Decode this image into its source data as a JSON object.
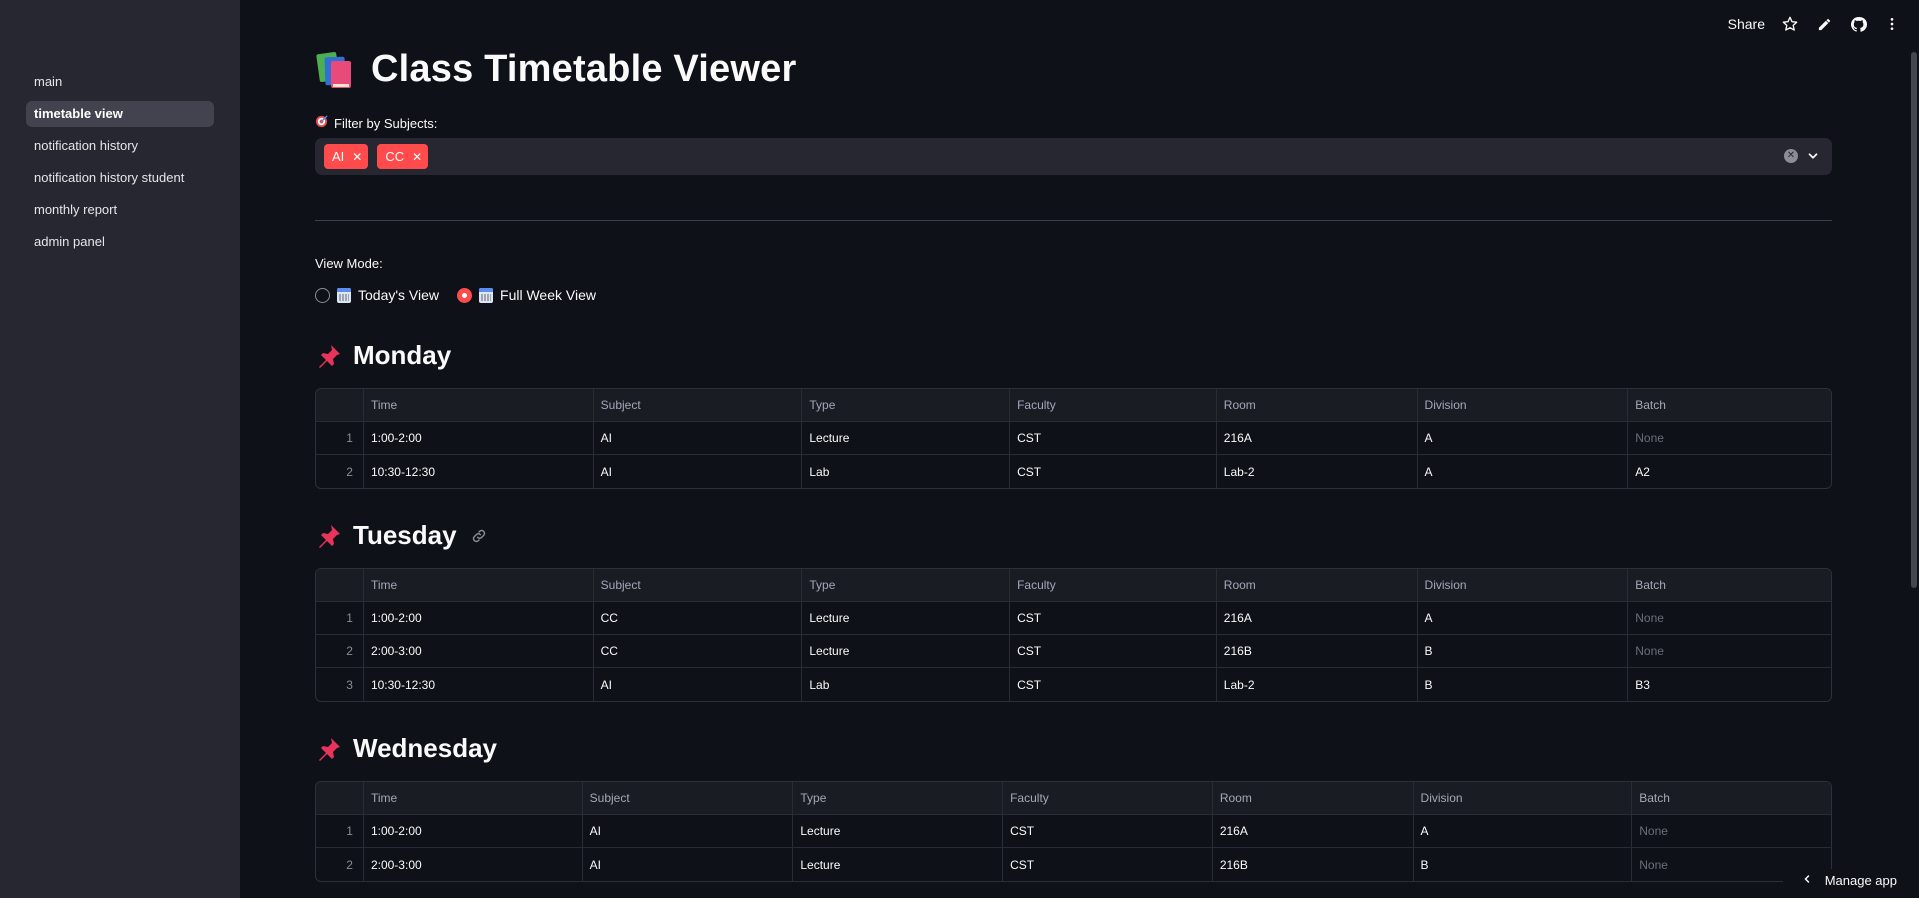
{
  "sidebar": {
    "items": [
      {
        "label": "main"
      },
      {
        "label": "timetable view"
      },
      {
        "label": "notification history"
      },
      {
        "label": "notification history student"
      },
      {
        "label": "monthly report"
      },
      {
        "label": "admin panel"
      }
    ]
  },
  "toolbar": {
    "share_label": "Share",
    "icons": [
      "star-icon",
      "pencil-icon",
      "github-icon",
      "more-vertical-icon"
    ]
  },
  "page": {
    "title": "Class Timetable Viewer",
    "title_icon": "books-emoji-icon"
  },
  "filter": {
    "label": "Filter by Subjects:",
    "label_icon": "target-icon",
    "tags": [
      {
        "label": "AI"
      },
      {
        "label": "CC"
      }
    ]
  },
  "view_mode": {
    "label": "View Mode:",
    "options": [
      {
        "label": "Today's View",
        "selected": false
      },
      {
        "label": "Full Week View",
        "selected": true
      }
    ]
  },
  "table_columns": [
    "Time",
    "Subject",
    "Type",
    "Faculty",
    "Room",
    "Division",
    "Batch"
  ],
  "days": [
    {
      "name": "Monday",
      "rows": [
        {
          "idx": "1",
          "cells": [
            "1:00-2:00",
            "AI",
            "Lecture",
            "CST",
            "216A",
            "A",
            "None"
          ]
        },
        {
          "idx": "2",
          "cells": [
            "10:30-12:30",
            "AI",
            "Lab",
            "CST",
            "Lab-2",
            "A",
            "A2"
          ]
        }
      ]
    },
    {
      "name": "Tuesday",
      "rows": [
        {
          "idx": "1",
          "cells": [
            "1:00-2:00",
            "CC",
            "Lecture",
            "CST",
            "216A",
            "A",
            "None"
          ]
        },
        {
          "idx": "2",
          "cells": [
            "2:00-3:00",
            "CC",
            "Lecture",
            "CST",
            "216B",
            "B",
            "None"
          ]
        },
        {
          "idx": "3",
          "cells": [
            "10:30-12:30",
            "AI",
            "Lab",
            "CST",
            "Lab-2",
            "B",
            "B3"
          ]
        }
      ]
    },
    {
      "name": "Wednesday",
      "rows": [
        {
          "idx": "1",
          "cells": [
            "1:00-2:00",
            "AI",
            "Lecture",
            "CST",
            "216A",
            "A",
            "None"
          ]
        },
        {
          "idx": "2",
          "cells": [
            "2:00-3:00",
            "AI",
            "Lecture",
            "CST",
            "216B",
            "B",
            "None"
          ]
        }
      ]
    }
  ],
  "manage_app_label": "Manage app",
  "colors": {
    "accent": "#ff4b4b",
    "background": "#0e1117",
    "sidebar": "#262730"
  }
}
